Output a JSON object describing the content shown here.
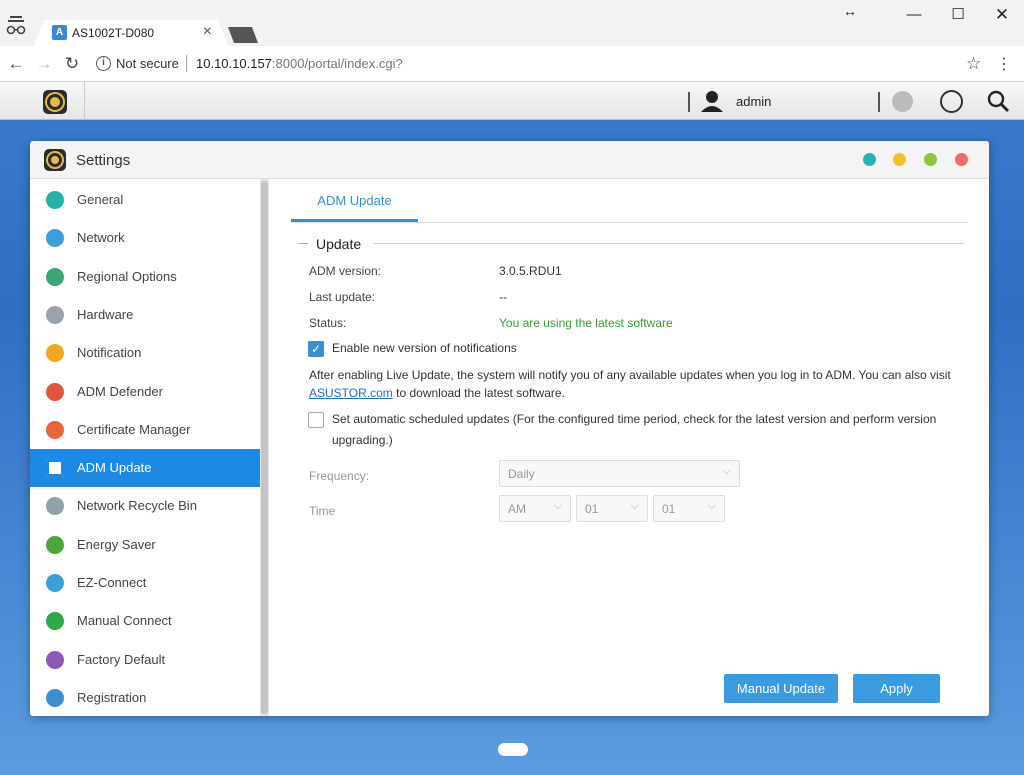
{
  "browser": {
    "tab_title": "AS1002T-D080",
    "tab_favicon": "A",
    "not_secure": "Not secure",
    "url_host": "10.10.10.157",
    "url_rest": ":8000/portal/index.cgi?"
  },
  "taskbar": {
    "username": "admin"
  },
  "window": {
    "title": "Settings",
    "dots": [
      "#2ab3b3",
      "#f2c12e",
      "#8dc63f",
      "#f06b6b"
    ]
  },
  "sidebar": {
    "items": [
      {
        "label": "General",
        "color": "#21b3a4"
      },
      {
        "label": "Network",
        "color": "#3aa0d8"
      },
      {
        "label": "Regional Options",
        "color": "#3aa876"
      },
      {
        "label": "Hardware",
        "color": "#9aa3ad"
      },
      {
        "label": "Notification",
        "color": "#f2a61e"
      },
      {
        "label": "ADM Defender",
        "color": "#e0553c"
      },
      {
        "label": "Certificate Manager",
        "color": "#e8653d"
      },
      {
        "label": "ADM Update",
        "color": "#ffffff"
      },
      {
        "label": "Network Recycle Bin",
        "color": "#8fa3a8"
      },
      {
        "label": "Energy Saver",
        "color": "#4aa83a"
      },
      {
        "label": "EZ-Connect",
        "color": "#3aa0d8"
      },
      {
        "label": "Manual Connect",
        "color": "#2fa84a"
      },
      {
        "label": "Factory Default",
        "color": "#8e58b8"
      },
      {
        "label": "Registration",
        "color": "#3a8fd1"
      }
    ],
    "active_index": 7
  },
  "content": {
    "tab_label": "ADM Update",
    "section_title": "Update",
    "adm_version_label": "ADM version:",
    "adm_version_value": "3.0.5.RDU1",
    "last_update_label": "Last update:",
    "last_update_value": "--",
    "status_label": "Status:",
    "status_value": "You are using the latest software",
    "notify_checkbox_label": "Enable new version of notifications",
    "notify_checked": true,
    "desc_part1": "After enabling Live Update, the system will notify you of any available updates when you log in to ADM. You can also visit ",
    "desc_link": "ASUSTOR.com",
    "desc_part2": " to download the latest software.",
    "auto_checkbox_label": "Set automatic scheduled updates (For the configured time period, check for the latest version and perform version upgrading.)",
    "auto_checked": false,
    "frequency_label": "Frequency:",
    "frequency_value": "Daily",
    "time_label": "Time",
    "time_ampm": "AM",
    "time_hour": "01",
    "time_minute": "01",
    "manual_update_button": "Manual Update",
    "apply_button": "Apply"
  }
}
